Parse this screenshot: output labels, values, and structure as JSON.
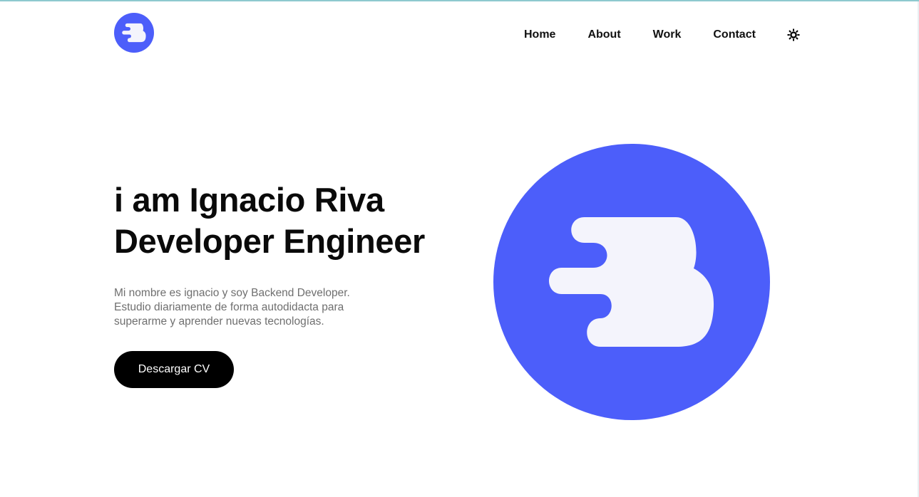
{
  "header": {
    "logo_icon": "brand-b-logo-icon",
    "nav": {
      "home": "Home",
      "about": "About",
      "work": "Work",
      "contact": "Contact"
    },
    "theme_icon": "sun-icon"
  },
  "hero": {
    "title_line1": "i am Ignacio Riva",
    "title_line2": "Developer Engineer",
    "desc_line1": "Mi nombre es ignacio y soy Backend Developer.",
    "desc_line2": "Estudio diariamente de forma autodidacta para",
    "desc_line3": "superarme y aprender nuevas tecnologías.",
    "cv_button": "Descargar CV",
    "image_icon": "brand-b-logo-large-icon"
  },
  "colors": {
    "brand": "#4c5efa",
    "mark": "#f4f4fc",
    "text": "#0a0a0a",
    "muted": "#6f6f6f",
    "button": "#000000"
  }
}
